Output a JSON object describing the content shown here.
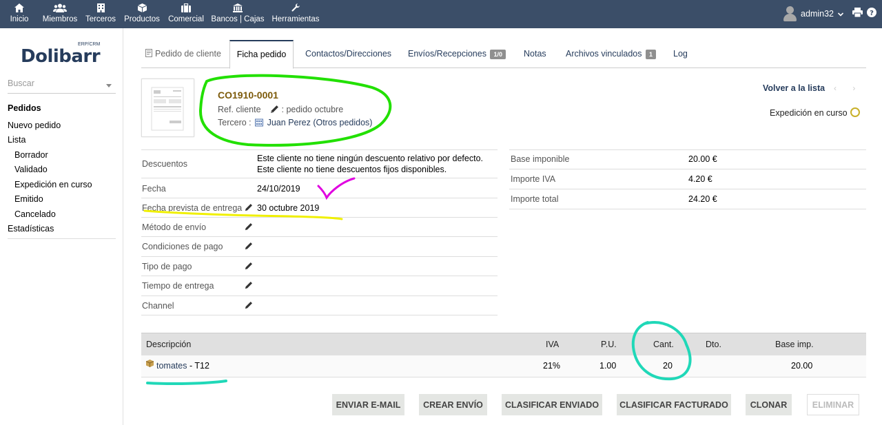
{
  "topmenu": {
    "items": [
      {
        "label": "Inicio",
        "icon": "home-icon"
      },
      {
        "label": "Miembros",
        "icon": "members-icon"
      },
      {
        "label": "Terceros",
        "icon": "building-icon"
      },
      {
        "label": "Productos",
        "icon": "cube-icon"
      },
      {
        "label": "Comercial",
        "icon": "briefcase-icon"
      },
      {
        "label": "Bancos | Cajas",
        "icon": "bank-icon"
      },
      {
        "label": "Herramientas",
        "icon": "wrench-icon"
      }
    ],
    "user": "admin32",
    "colors": {
      "bar": "#3b4e68",
      "text": "#ffffff"
    }
  },
  "sidebar": {
    "logo": "Dolibarr",
    "logo_small": "ERP/CRM",
    "search_placeholder": "Buscar",
    "menu": [
      "Pedidos",
      "Nuevo pedido",
      "Lista",
      "Borrador",
      "Validado",
      "Expedición en curso",
      "Emitido",
      "Cancelado",
      "Estadísticas"
    ]
  },
  "tabs": [
    {
      "label": "Pedido de cliente"
    },
    {
      "label": "Ficha pedido"
    },
    {
      "label": "Contactos/Direcciones"
    },
    {
      "label": "Envíos/Recepciones",
      "badge": "1/0"
    },
    {
      "label": "Notas"
    },
    {
      "label": "Archivos vinculados",
      "badge": "1"
    },
    {
      "label": "Log"
    }
  ],
  "header": {
    "ref": "CO1910-0001",
    "ref_cliente_label": "Ref. cliente",
    "ref_cliente_value": ": pedido octubre",
    "tercero_label": "Tercero :",
    "tercero_name": "Juan Perez",
    "otros_pedidos": "(Otros pedidos)",
    "volver": "Volver a la lista",
    "prev": "‹",
    "next": "›",
    "status": "Expedición en curso"
  },
  "details": [
    {
      "key": "Descuentos",
      "value1": "Este cliente no tiene ningún descuento relativo por defecto.",
      "value2": "Este cliente no tiene descuentos fijos disponibles."
    },
    {
      "key": "Fecha",
      "value": "24/10/2019"
    },
    {
      "key": "Fecha prevista de entrega",
      "value": "30 octubre 2019"
    },
    {
      "key": "Método de envío",
      "value": ""
    },
    {
      "key": "Condiciones de pago",
      "value": ""
    },
    {
      "key": "Tipo de pago",
      "value": ""
    },
    {
      "key": "Tiempo de entrega",
      "value": ""
    },
    {
      "key": "Channel",
      "value": ""
    }
  ],
  "totals": [
    {
      "key": "Base imponible",
      "value": "20.00 €"
    },
    {
      "key": "Importe IVA",
      "value": "4.20 €"
    },
    {
      "key": "Importe total",
      "value": "24.20 €"
    }
  ],
  "lines": {
    "headers": [
      "Descripción",
      "IVA",
      "P.U.",
      "Cant.",
      "Dto.",
      "Base imp."
    ],
    "rows": [
      {
        "product": "tomates",
        "desc": " - T12",
        "iva": "21%",
        "pu": "1.00",
        "cant": "20",
        "dto": "",
        "base": "20.00"
      }
    ]
  },
  "buttons": [
    "ENVIAR E-MAIL",
    "CREAR ENVÍO",
    "CLASIFICAR ENVIADO",
    "CLASIFICAR FACTURADO",
    "CLONAR",
    "ELIMINAR"
  ],
  "annotation_colors": {
    "green": "#22e000",
    "magenta": "#e000e0",
    "yellow": "#f0f000",
    "teal": "#20d8b8"
  }
}
